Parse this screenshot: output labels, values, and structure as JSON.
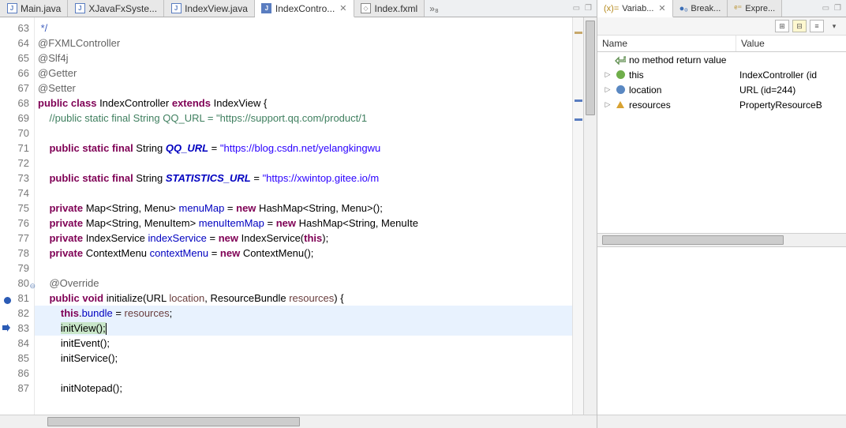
{
  "tabs": {
    "editor": [
      {
        "label": "Main.java",
        "active": false
      },
      {
        "label": "XJavaFxSyste...",
        "active": false
      },
      {
        "label": "IndexView.java",
        "active": false
      },
      {
        "label": "IndexContro...",
        "active": true
      },
      {
        "label": "Index.fxml",
        "active": false
      }
    ],
    "overflow": "»₈",
    "right": [
      {
        "label": "Variab...",
        "active": true,
        "prefix": "(x)="
      },
      {
        "label": "Break...",
        "active": false,
        "prefix": "●ₒ"
      },
      {
        "label": "Expre...",
        "active": false,
        "prefix": "ᵉ⁼"
      }
    ]
  },
  "code": {
    "lines": [
      {
        "n": 63,
        "html": " <span class='cmtb'>*/</span>"
      },
      {
        "n": 64,
        "html": "<span class='ann'>@FXMLController</span>"
      },
      {
        "n": 65,
        "html": "<span class='ann'>@Slf4j</span>"
      },
      {
        "n": 66,
        "html": "<span class='ann'>@Getter</span>"
      },
      {
        "n": 67,
        "html": "<span class='ann'>@Setter</span>"
      },
      {
        "n": 68,
        "html": "<span class='kw'>public</span> <span class='kw'>class</span> IndexController <span class='kw'>extends</span> IndexView {"
      },
      {
        "n": 69,
        "html": "    <span class='cmt'>//public static final String QQ_URL = \"https://support.qq.com/product/1</span>"
      },
      {
        "n": 70,
        "html": ""
      },
      {
        "n": 71,
        "html": "    <span class='kw'>public</span> <span class='kw'>static</span> <span class='kw'>final</span> String <span class='ital'><b>QQ_URL</b></span> = <span class='str'>\"https://blog.csdn.net/yelangkingwu</span>"
      },
      {
        "n": 72,
        "html": ""
      },
      {
        "n": 73,
        "html": "    <span class='kw'>public</span> <span class='kw'>static</span> <span class='kw'>final</span> String <span class='ital'><b>STATISTICS_URL</b></span> = <span class='str'>\"https://xwintop.gitee.io/m</span>"
      },
      {
        "n": 74,
        "html": ""
      },
      {
        "n": 75,
        "html": "    <span class='kw'>private</span> Map&lt;String, Menu&gt; <span class='field'>menuMap</span> = <span class='kw'>new</span> HashMap&lt;String, Menu&gt;();"
      },
      {
        "n": 76,
        "html": "    <span class='kw'>private</span> Map&lt;String, MenuItem&gt; <span class='field'>menuItemMap</span> = <span class='kw'>new</span> HashMap&lt;String, MenuIte"
      },
      {
        "n": 77,
        "html": "    <span class='kw'>private</span> IndexService <span class='field'>indexService</span> = <span class='kw'>new</span> IndexService(<span class='kw'>this</span>);"
      },
      {
        "n": 78,
        "html": "    <span class='kw'>private</span> ContextMenu <span class='field'>contextMenu</span> = <span class='kw'>new</span> ContextMenu();"
      },
      {
        "n": 79,
        "html": ""
      },
      {
        "n": 80,
        "html": "    <span class='ann'>@Override</span>",
        "fold": true
      },
      {
        "n": 81,
        "html": "    <span class='kw'>public</span> <span class='kw'>void</span> initialize(URL <span class='param'>location</span>, ResourceBundle <span class='param'>resources</span>) {",
        "bp": "dot"
      },
      {
        "n": 82,
        "html": "        <span class='kw'>this</span>.<span class='field'>bundle</span> = <span class='param'>resources</span>;",
        "cls": "hl-line"
      },
      {
        "n": 83,
        "html": "        initView();<span class='cursor'></span>",
        "cls": "hl-line",
        "exec": true,
        "bp": "arrow"
      },
      {
        "n": 84,
        "html": "        initEvent();"
      },
      {
        "n": 85,
        "html": "        initService();"
      },
      {
        "n": 86,
        "html": ""
      },
      {
        "n": 87,
        "html": "        initNotepad();"
      }
    ]
  },
  "vars": {
    "header": {
      "name": "Name",
      "value": "Value"
    },
    "rows": [
      {
        "tw": "",
        "ico": "ret",
        "name": "no method return value",
        "val": ""
      },
      {
        "tw": "▷",
        "ico": "this",
        "name": "this",
        "val": "IndexController  (id"
      },
      {
        "tw": "▷",
        "ico": "loc",
        "name": "location",
        "val": "URL  (id=244)"
      },
      {
        "tw": "▷",
        "ico": "res",
        "name": "resources",
        "val": "PropertyResourceB"
      }
    ]
  }
}
